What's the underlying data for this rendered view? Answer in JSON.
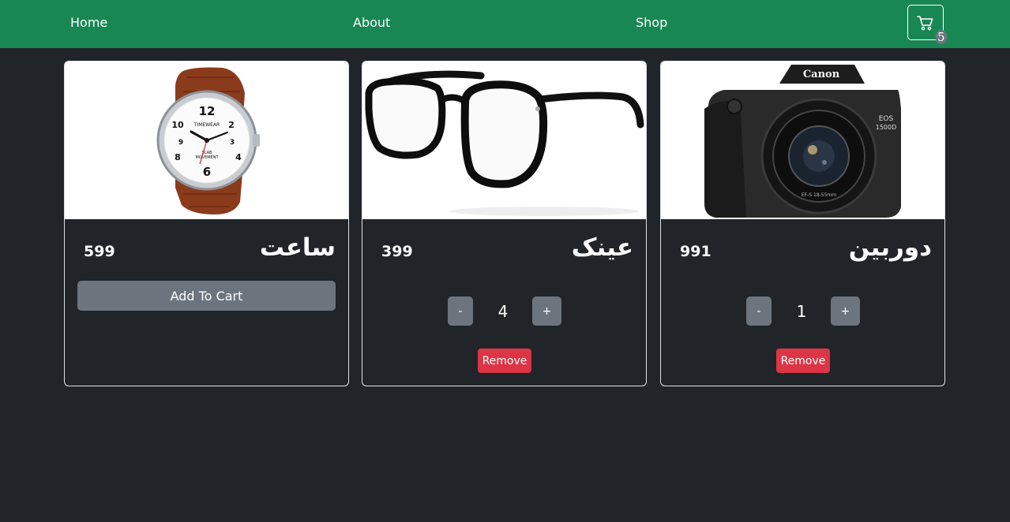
{
  "nav": {
    "home": "Home",
    "about": "About",
    "shop": "Shop",
    "cart_count": "5",
    "cart_icon": "cart-icon"
  },
  "products": [
    {
      "title": "ساعت",
      "price": "599",
      "image_icon": "wristwatch-icon",
      "add_label": "Add To Cart"
    },
    {
      "title": "عینک",
      "price": "399",
      "image_icon": "eyeglasses-icon",
      "minus": "-",
      "plus": "+",
      "quantity": "4",
      "remove_label": "Remove"
    },
    {
      "title": "دوربین",
      "price": "991",
      "image_icon": "camera-icon",
      "minus": "-",
      "plus": "+",
      "quantity": "1",
      "remove_label": "Remove"
    }
  ],
  "colors": {
    "navbar": "#198754",
    "background": "#212529",
    "button_secondary": "#6c757d",
    "button_danger": "#dc3545"
  },
  "images": {
    "watch_logo": "TIMEWEAR",
    "watch_sub": "SLAB MOVEMENT",
    "camera_logo": "Canon",
    "camera_model": "EOS 1500D"
  }
}
